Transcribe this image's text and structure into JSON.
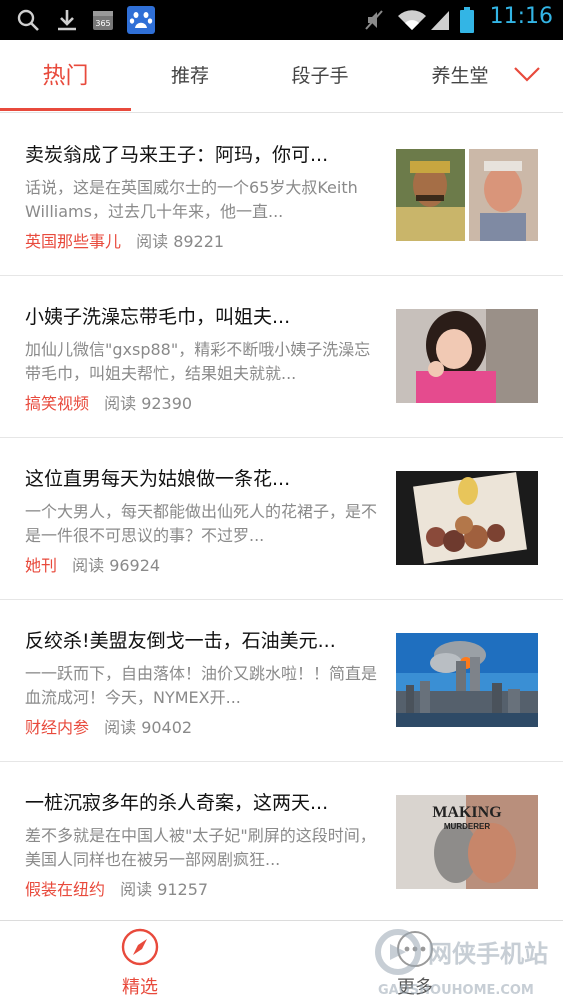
{
  "status_bar": {
    "time": "11:16",
    "icons": [
      "search-icon",
      "download-icon",
      "calendar-365-icon",
      "baidu-paw-icon",
      "mute-icon",
      "wifi-icon",
      "signal-icon",
      "battery-icon"
    ],
    "calendar_text": "365",
    "accent_color": "#33b5e5"
  },
  "tabs": {
    "items": [
      "热门",
      "推荐",
      "段子手",
      "养生堂"
    ],
    "active_index": 0,
    "more_icon": "chevron-down-icon",
    "accent_color": "#e84a3c"
  },
  "feed": [
    {
      "title": "卖炭翁成了马来王子：阿玛，你可...",
      "summary": "话说，这是在英国威尔士的一个65岁大叔Keith Williams，过去几十年来，他一直...",
      "source": "英国那些事儿",
      "reads": "阅读 89221",
      "thumb": "two-men-portrait-thumbnail"
    },
    {
      "title": "小姨子洗澡忘带毛巾，叫姐夫...",
      "summary": "加仙儿微信\"gxsp88\"，精彩不断哦小姨子洗澡忘带毛巾，叫姐夫帮忙，结果姐夫就就...",
      "source": "搞笑视频",
      "reads": "阅读 92390",
      "thumb": "girl-in-pink-thumbnail"
    },
    {
      "title": "这位直男每天为姑娘做一条花...",
      "summary": "一个大男人，每天都能做出仙死人的花裙子，是不是一件很不可思议的事？不过罗...",
      "source": "她刊",
      "reads": "阅读 96924",
      "thumb": "flower-dress-thumbnail"
    },
    {
      "title": "反绞杀!美盟友倒戈一击，石油美元...",
      "summary": "一一跃而下，自由落体！油价又跳水啦！！简直是血流成河！今天，NYMEX开...",
      "source": "财经内参",
      "reads": "阅读 90402",
      "thumb": "city-skyline-smoke-thumbnail"
    },
    {
      "title": "一桩沉寂多年的杀人奇案，这两天...",
      "summary": "差不多就是在中国人被\"太子妃\"刷屏的这段时间，美国人同样也在被另一部网剧疯狂...",
      "source": "假装在纽约",
      "reads": "阅读 91257",
      "thumb": "making-a-murderer-thumbnail",
      "thumb_text_1": "MAKING",
      "thumb_text_2": "MURDERER"
    }
  ],
  "bottom_nav": {
    "items": [
      {
        "label": "精选",
        "icon": "compass-icon",
        "active": true
      },
      {
        "label": "更多",
        "icon": "more-icon",
        "active": false
      }
    ]
  },
  "watermark": {
    "brand": "网侠手机站",
    "url": "GAOSHOUHOME.COM"
  }
}
